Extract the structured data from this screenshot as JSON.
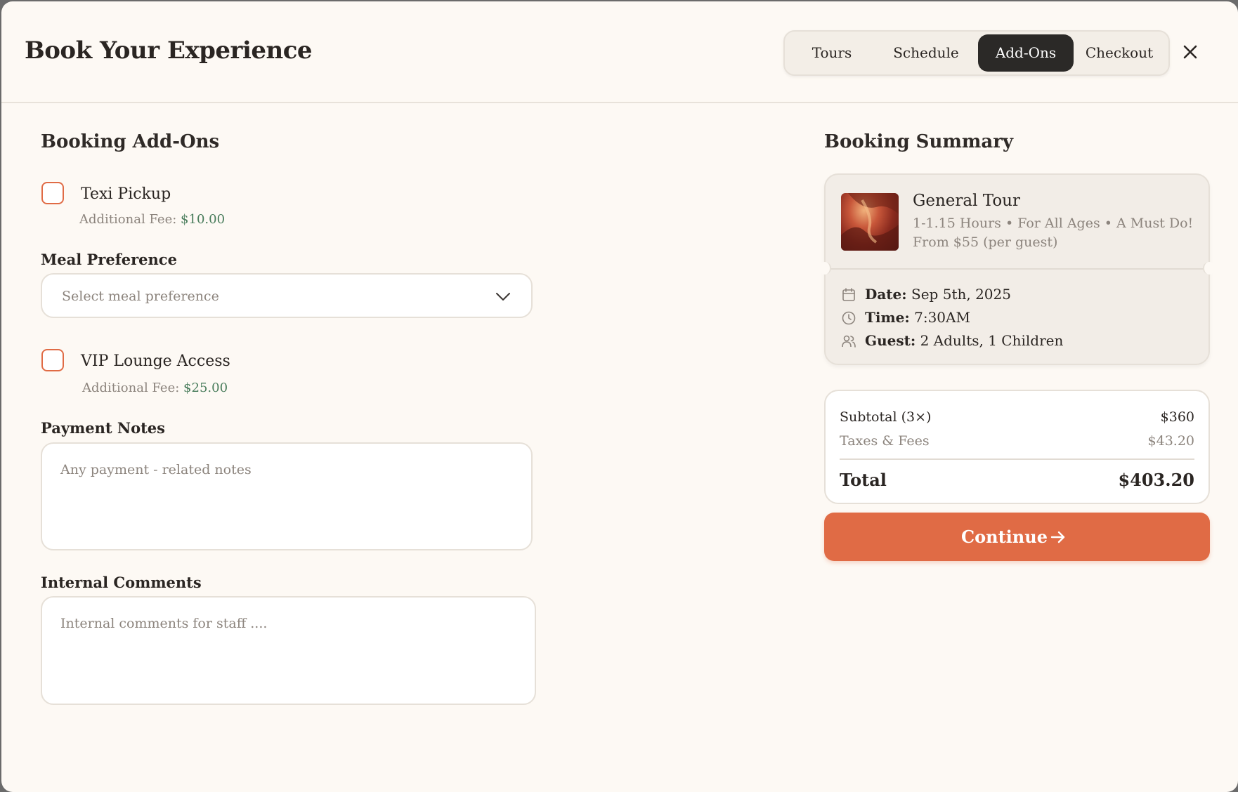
{
  "header": {
    "title": "Book Your Experience",
    "tabs": [
      {
        "label": "Tours",
        "active": false
      },
      {
        "label": "Schedule",
        "active": false
      },
      {
        "label": "Add-Ons",
        "active": true
      },
      {
        "label": "Checkout",
        "active": false
      }
    ],
    "close_icon": "close-icon"
  },
  "addons": {
    "title": "Booking Add-Ons",
    "taxi": {
      "label": "Texi Pickup",
      "fee_prefix": "Additional Fee:",
      "fee": "$10.00",
      "checked": false
    },
    "meal": {
      "label": "Meal Preference",
      "placeholder": "Select meal preference"
    },
    "vip": {
      "label": "VIP Lounge Access",
      "fee_prefix": "Additional Fee:",
      "fee": "$25.00",
      "checked": false
    },
    "payment_notes": {
      "label": "Payment Notes",
      "placeholder": "Any payment - related notes"
    },
    "internal_comments": {
      "label": "Internal Comments",
      "placeholder": "Internal comments for staff ...."
    }
  },
  "summary": {
    "title": "Booking Summary",
    "tour": {
      "name": "General Tour",
      "desc_line1": "1-1.15 Hours • For All Ages • A Must Do!",
      "desc_line2": "From $55 (per guest)"
    },
    "date": {
      "label": "Date:",
      "value": "Sep 5th, 2025",
      "icon": "calendar-icon"
    },
    "time": {
      "label": "Time:",
      "value": "7:30AM",
      "icon": "clock-icon"
    },
    "guest": {
      "label": "Guest:",
      "value": "2 Adults, 1 Children",
      "icon": "users-icon"
    },
    "subtotal": {
      "label": "Subtotal (3×)",
      "value": "$360"
    },
    "taxes": {
      "label": "Taxes & Fees",
      "value": "$43.20"
    },
    "total": {
      "label": "Total",
      "value": "$403.20"
    },
    "continue_label": "Continue"
  },
  "colors": {
    "accent": "#e06b45",
    "active_tab": "#2b2927",
    "fee_green": "#4a7d5c",
    "background": "#fdf9f4"
  }
}
